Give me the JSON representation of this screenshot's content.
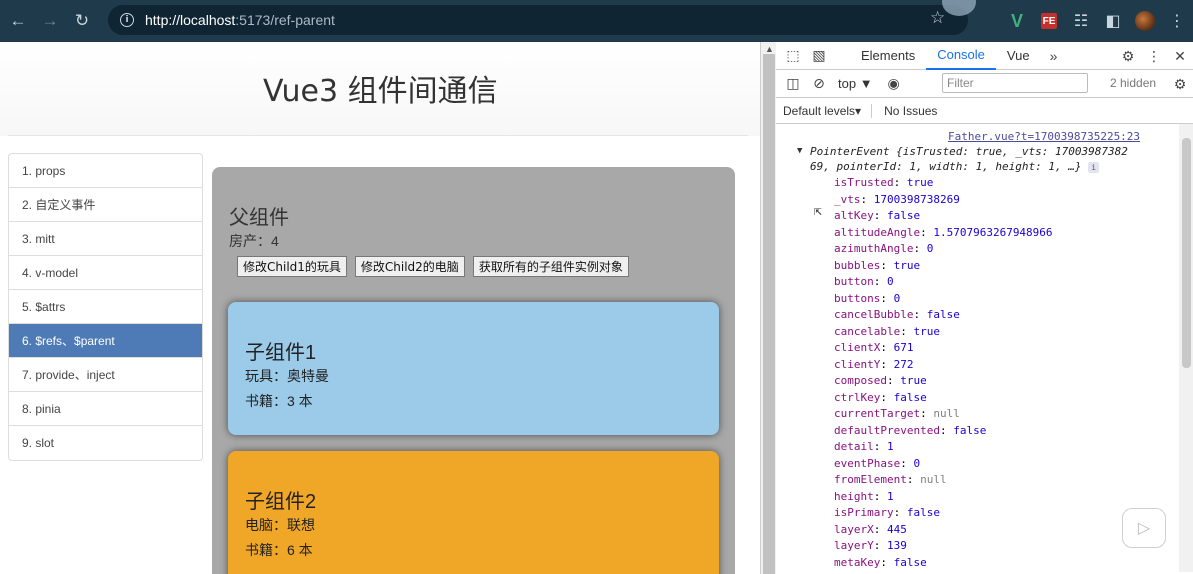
{
  "browser": {
    "url_scheme_host": "http://localhost",
    "url_port_path": ":5173/ref-parent"
  },
  "page": {
    "title": "Vue3 组件间通信",
    "sidebar": {
      "items": [
        {
          "label": "1. props"
        },
        {
          "label": "2. 自定义事件"
        },
        {
          "label": "3. mitt"
        },
        {
          "label": "4. v-model"
        },
        {
          "label": "5. $attrs"
        },
        {
          "label": "6. $refs、$parent",
          "active": true
        },
        {
          "label": "7. provide、inject"
        },
        {
          "label": "8. pinia"
        },
        {
          "label": "9. slot"
        }
      ]
    },
    "father": {
      "title": "父组件",
      "house": "房产：4",
      "buttons": [
        "修改Child1的玩具",
        "修改Child2的电脑",
        "获取所有的子组件实例对象"
      ]
    },
    "child1": {
      "title": "子组件1",
      "line1": "玩具：奥特曼",
      "line2": "书籍：3 本",
      "color": "#9ccbe9"
    },
    "child2": {
      "title": "子组件2",
      "line1": "电脑：联想",
      "line2": "书籍：6 本",
      "color": "#f0a626"
    }
  },
  "devtools": {
    "tabs": [
      {
        "label": "Elements"
      },
      {
        "label": "Console",
        "active": true
      },
      {
        "label": "Vue"
      }
    ],
    "context": "top",
    "filter_placeholder": "Filter",
    "hidden_count": "2 hidden",
    "levels": "Default levels",
    "issues": "No Issues",
    "source_link": "Father.vue?t=1700398735225:23",
    "object_head_line1": "PointerEvent {isTrusted: true, _vts: 17003987382",
    "object_head_line2": "69, pointerId: 1, width: 1, height: 1, …}",
    "properties": [
      {
        "key": "isTrusted",
        "value": "true",
        "type": "bool"
      },
      {
        "key": "_vts",
        "value": "1700398738269",
        "type": "num"
      },
      {
        "key": "altKey",
        "value": "false",
        "type": "bool"
      },
      {
        "key": "altitudeAngle",
        "value": "1.5707963267948966",
        "type": "num"
      },
      {
        "key": "azimuthAngle",
        "value": "0",
        "type": "num"
      },
      {
        "key": "bubbles",
        "value": "true",
        "type": "bool"
      },
      {
        "key": "button",
        "value": "0",
        "type": "num"
      },
      {
        "key": "buttons",
        "value": "0",
        "type": "num"
      },
      {
        "key": "cancelBubble",
        "value": "false",
        "type": "bool"
      },
      {
        "key": "cancelable",
        "value": "true",
        "type": "bool"
      },
      {
        "key": "clientX",
        "value": "671",
        "type": "num"
      },
      {
        "key": "clientY",
        "value": "272",
        "type": "num"
      },
      {
        "key": "composed",
        "value": "true",
        "type": "bool"
      },
      {
        "key": "ctrlKey",
        "value": "false",
        "type": "bool"
      },
      {
        "key": "currentTarget",
        "value": "null",
        "type": "null"
      },
      {
        "key": "defaultPrevented",
        "value": "false",
        "type": "bool"
      },
      {
        "key": "detail",
        "value": "1",
        "type": "num"
      },
      {
        "key": "eventPhase",
        "value": "0",
        "type": "num"
      },
      {
        "key": "fromElement",
        "value": "null",
        "type": "null"
      },
      {
        "key": "height",
        "value": "1",
        "type": "num"
      },
      {
        "key": "isPrimary",
        "value": "false",
        "type": "bool"
      },
      {
        "key": "layerX",
        "value": "445",
        "type": "num"
      },
      {
        "key": "layerY",
        "value": "139",
        "type": "num"
      },
      {
        "key": "metaKey",
        "value": "false",
        "type": "bool"
      }
    ]
  }
}
